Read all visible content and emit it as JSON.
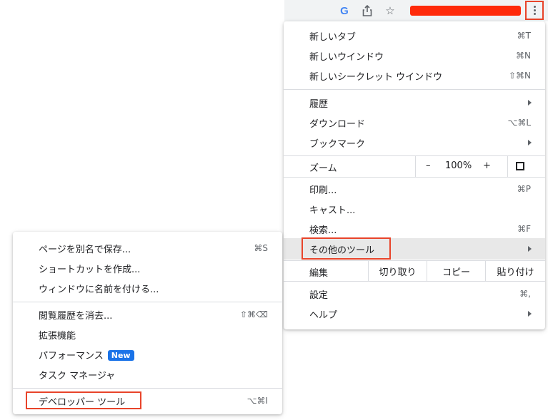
{
  "toolbar": {
    "g_icon": "G",
    "icons": [
      "google-icon",
      "share-icon",
      "star-icon",
      "more-icon"
    ]
  },
  "main_menu": {
    "new_tab": {
      "label": "新しいタブ",
      "shortcut": "⌘T"
    },
    "new_window": {
      "label": "新しいウインドウ",
      "shortcut": "⌘N"
    },
    "new_incognito": {
      "label": "新しいシークレット ウインドウ",
      "shortcut": "⇧⌘N"
    },
    "history": {
      "label": "履歴"
    },
    "downloads": {
      "label": "ダウンロード",
      "shortcut": "⌥⌘L"
    },
    "bookmarks": {
      "label": "ブックマーク"
    },
    "zoom": {
      "label": "ズーム",
      "minus": "–",
      "value": "100%",
      "plus": "+"
    },
    "print": {
      "label": "印刷...",
      "shortcut": "⌘P"
    },
    "cast": {
      "label": "キャスト..."
    },
    "find": {
      "label": "検索...",
      "shortcut": "⌘F"
    },
    "more_tools": {
      "label": "その他のツール"
    },
    "edit": {
      "label": "編集",
      "cut": "切り取り",
      "copy": "コピー",
      "paste": "貼り付け"
    },
    "settings": {
      "label": "設定",
      "shortcut": "⌘,"
    },
    "help": {
      "label": "ヘルプ"
    }
  },
  "sub_menu": {
    "save_page": {
      "label": "ページを別名で保存...",
      "shortcut": "⌘S"
    },
    "create_shortcut": {
      "label": "ショートカットを作成..."
    },
    "name_window": {
      "label": "ウィンドウに名前を付ける..."
    },
    "clear_data": {
      "label": "閲覧履歴を消去...",
      "shortcut": "⇧⌘⌫"
    },
    "extensions": {
      "label": "拡張機能"
    },
    "performance": {
      "label": "パフォーマンス",
      "badge": "New"
    },
    "task_manager": {
      "label": "タスク マネージャ"
    },
    "dev_tools": {
      "label": "デベロッパー ツール",
      "shortcut": "⌥⌘I"
    }
  },
  "colors": {
    "highlight_box": "#e8442a",
    "new_badge": "#1a73e8",
    "redaction": "#ff2a0a"
  }
}
